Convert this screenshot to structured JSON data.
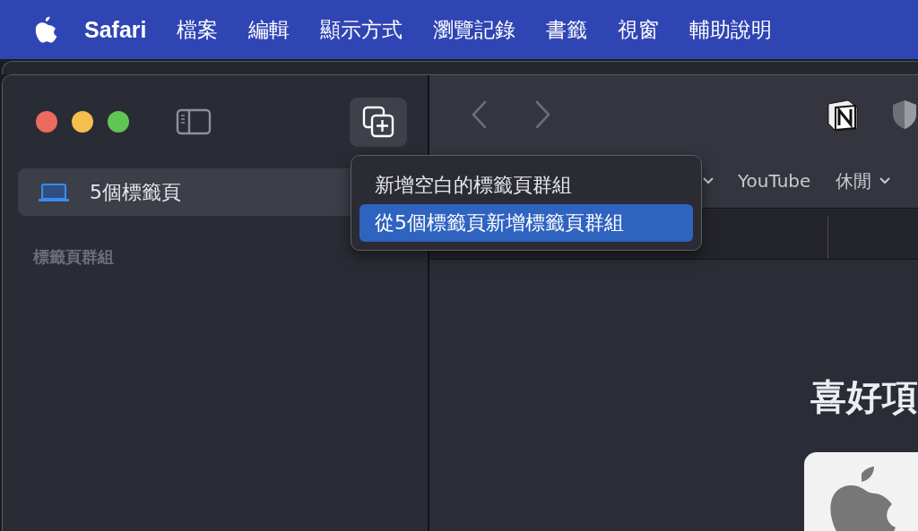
{
  "menu_bar": {
    "app": "Safari",
    "items": [
      "檔案",
      "編輯",
      "顯示方式",
      "瀏覽記錄",
      "書籤",
      "視窗",
      "輔助說明"
    ]
  },
  "sidebar": {
    "items": [
      {
        "label": "5個標籤頁",
        "selected": true
      }
    ],
    "section_header": "標籤頁群組"
  },
  "new_group_menu": {
    "items": [
      {
        "label": "新增空白的標籤頁群組",
        "selected": false
      },
      {
        "label": "從5個標籤頁新增標籤頁群組",
        "selected": true
      }
    ]
  },
  "favorites_bar": [
    {
      "label": "YouTube",
      "kind": "link"
    },
    {
      "label": "休閒",
      "kind": "folder"
    }
  ],
  "content": {
    "heading": "喜好項"
  }
}
